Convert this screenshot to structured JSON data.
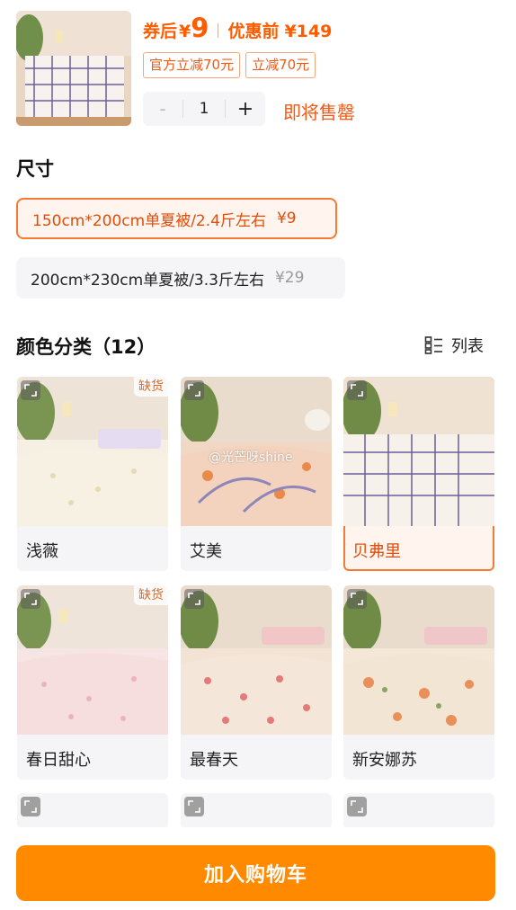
{
  "header": {
    "coupon_price_label": "券后",
    "currency": "¥",
    "coupon_price": "9",
    "original_price_label": "优惠前",
    "original_price": "¥149",
    "coupons": [
      "官方立减70元",
      "立减70元"
    ],
    "quantity": "1",
    "minus_label": "-",
    "plus_label": "+",
    "stock_hint": "即将售罄"
  },
  "size": {
    "title": "尺寸",
    "options": [
      {
        "label": "150cm*200cm单夏被/2.4斤左右",
        "price": "¥9",
        "selected": true
      },
      {
        "label": "200cm*230cm单夏被/3.3斤左右",
        "price": "¥29",
        "selected": false
      }
    ]
  },
  "colors": {
    "title": "颜色分类（12）",
    "view_toggle_label": "列表",
    "watermark": "@光芒呀shine",
    "items": [
      {
        "name": "浅薇",
        "badge": "缺货",
        "selected": false
      },
      {
        "name": "艾美",
        "badge": "",
        "selected": false
      },
      {
        "name": "贝弗里",
        "badge": "",
        "selected": true
      },
      {
        "name": "春日甜心",
        "badge": "缺货",
        "selected": false
      },
      {
        "name": "最春天",
        "badge": "",
        "selected": false
      },
      {
        "name": "新安娜苏",
        "badge": "",
        "selected": false
      }
    ]
  },
  "bottom": {
    "cart_button": "加入购物车"
  },
  "colors_theme": {
    "accent": "#ff5c00",
    "button": "#ff8a00",
    "selected_border": "#f57a33"
  },
  "icons": [
    "expand-icon",
    "list-view-icon"
  ]
}
